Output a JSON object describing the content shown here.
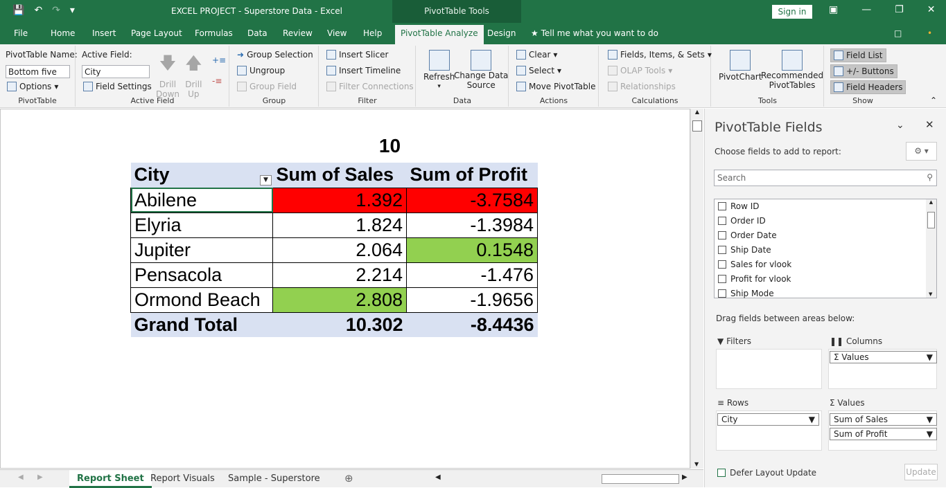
{
  "title_bar": {
    "title": "EXCEL PROJECT - Superstore Data  -  Excel",
    "context_label": "PivotTable Tools",
    "sign_in": "Sign in"
  },
  "tabs": [
    "File",
    "Home",
    "Insert",
    "Page Layout",
    "Formulas",
    "Data",
    "Review",
    "View",
    "Help",
    "PivotTable Analyze",
    "Design"
  ],
  "active_tab": "PivotTable Analyze",
  "tell_me": "Tell me what you want to do",
  "ribbon": {
    "pivottable": {
      "name_label": "PivotTable Name:",
      "name_value": "Bottom five",
      "options": "Options",
      "group": "PivotTable"
    },
    "active_field": {
      "label": "Active Field:",
      "value": "City",
      "field_settings": "Field Settings",
      "drill_down_1": "Drill",
      "drill_down_2": "Down",
      "drill_up_1": "Drill",
      "drill_up_2": "Up",
      "group": "Active Field"
    },
    "group": {
      "group_selection": "Group Selection",
      "ungroup": "Ungroup",
      "group_field": "Group Field",
      "group": "Group"
    },
    "filter": {
      "insert_slicer": "Insert Slicer",
      "insert_timeline": "Insert Timeline",
      "filter_connections": "Filter Connections",
      "group": "Filter"
    },
    "data": {
      "refresh": "Refresh",
      "change_1": "Change Data",
      "change_2": "Source",
      "group": "Data"
    },
    "actions": {
      "clear": "Clear",
      "select": "Select",
      "move": "Move PivotTable",
      "group": "Actions"
    },
    "calculations": {
      "fields": "Fields, Items, & Sets",
      "olap": "OLAP Tools",
      "relationships": "Relationships",
      "group": "Calculations"
    },
    "tools": {
      "pivotchart": "PivotChart",
      "recommended_1": "Recommended",
      "recommended_2": "PivotTables",
      "group": "Tools"
    },
    "show": {
      "field_list": "Field List",
      "buttons": "+/- Buttons",
      "field_headers": "Field Headers",
      "group": "Show"
    }
  },
  "sheet": {
    "top_value": "10",
    "headers": [
      "City",
      "Sum of Sales",
      "Sum of Profit"
    ],
    "rows": [
      {
        "city": "Abilene",
        "sales": "1.392",
        "profit": "-3.7584"
      },
      {
        "city": "Elyria",
        "sales": "1.824",
        "profit": "-1.3984"
      },
      {
        "city": "Jupiter",
        "sales": "2.064",
        "profit": "0.1548"
      },
      {
        "city": "Pensacola",
        "sales": "2.214",
        "profit": "-1.476"
      },
      {
        "city": "Ormond Beach",
        "sales": "2.808",
        "profit": "-1.9656"
      }
    ],
    "total": {
      "label": "Grand Total",
      "sales": "10.302",
      "profit": "-8.4436"
    },
    "highlight_colors": {
      "red": "#ff0000",
      "green": "#92d050"
    }
  },
  "sheet_tabs": [
    "Report Sheet",
    "Report Visuals",
    "Sample - Superstore"
  ],
  "pane": {
    "title": "PivotTable Fields",
    "choose": "Choose fields to add to report:",
    "search_placeholder": "Search",
    "fields": [
      "Row ID",
      "Order ID",
      "Order Date",
      "Ship Date",
      "Sales for vlook",
      "Profit for vlook",
      "Ship Mode"
    ],
    "drag_label": "Drag fields between areas below:",
    "filters": "Filters",
    "columns": "Columns",
    "columns_item": "Values",
    "rows": "Rows",
    "rows_item": "City",
    "values": "Values",
    "values_items": [
      "Sum of Sales",
      "Sum of Profit"
    ],
    "defer": "Defer Layout Update",
    "update": "Update"
  }
}
